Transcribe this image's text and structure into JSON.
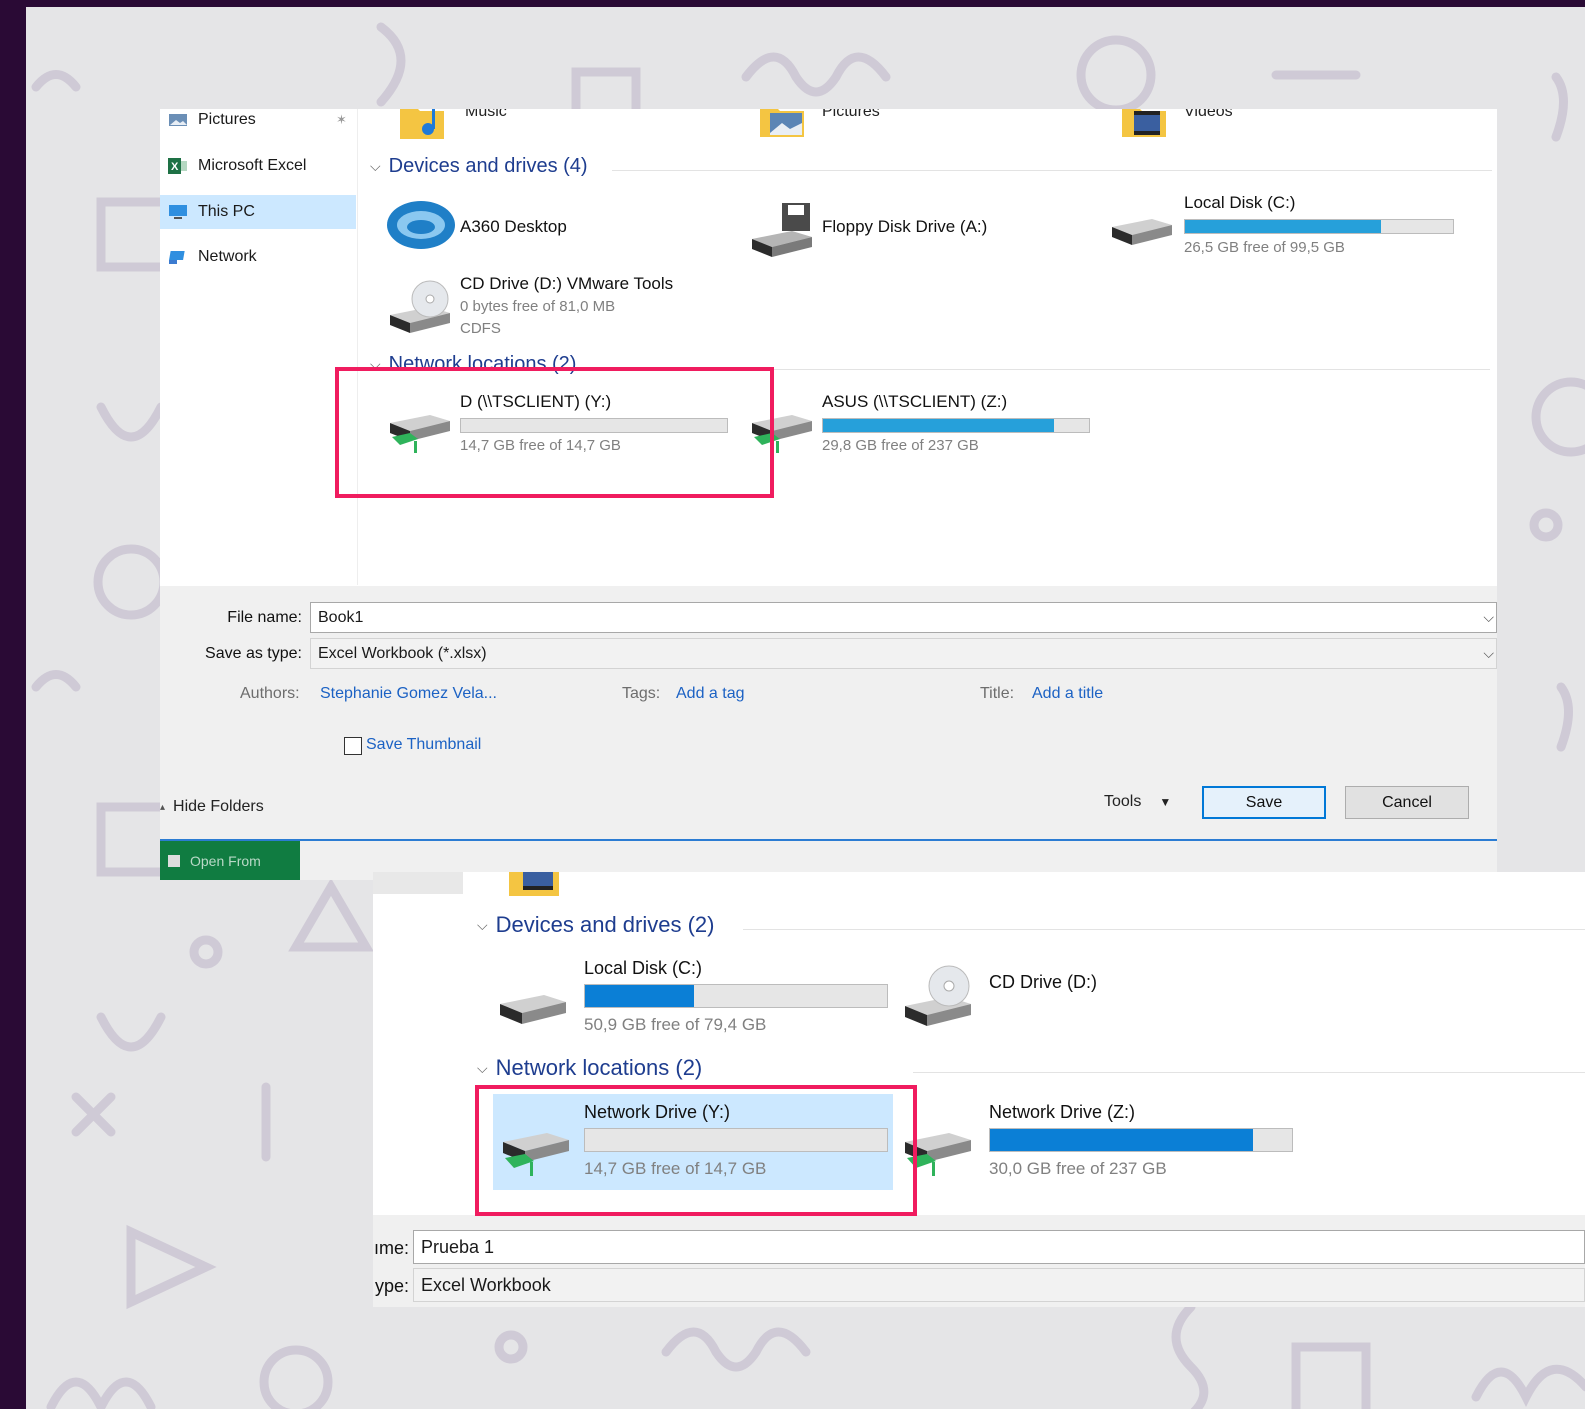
{
  "colors": {
    "frame": "#2a0a35",
    "backdrop": "#e5e5e7",
    "highlight": "#f01c5f",
    "accent": "#26a0da",
    "link": "#1c62c4",
    "selection": "#cce8ff"
  },
  "dialog1": {
    "nav": [
      {
        "label": "Pictures",
        "icon": "pictures-icon",
        "pinned": true
      },
      {
        "label": "Microsoft Excel",
        "icon": "excel-icon"
      },
      {
        "label": "This PC",
        "icon": "this-pc-icon",
        "selected": true
      },
      {
        "label": "Network",
        "icon": "network-icon"
      }
    ],
    "folders_top": [
      {
        "label": "Music",
        "icon": "music-folder-icon"
      },
      {
        "label": "Pictures",
        "icon": "pictures-folder-icon"
      },
      {
        "label": "Videos",
        "icon": "videos-folder-icon"
      }
    ],
    "devices_header": "Devices and drives (4)",
    "devices": [
      {
        "name": "A360 Desktop",
        "icon": "a360-desktop-icon"
      },
      {
        "name": "Floppy Disk Drive (A:)",
        "icon": "floppy-drive-icon"
      },
      {
        "name": "Local Disk (C:)",
        "icon": "hard-disk-icon",
        "free_text": "26,5 GB free of 99,5 GB",
        "used_fraction": 0.73
      },
      {
        "name": "CD Drive (D:) VMware Tools",
        "icon": "cd-drive-icon",
        "sub1": "0 bytes free of 81,0 MB",
        "sub2": "CDFS"
      }
    ],
    "network_header": "Network locations (2)",
    "network": [
      {
        "name": "D (\\\\TSCLIENT) (Y:)",
        "icon": "network-drive-icon",
        "free_text": "14,7 GB free of 14,7 GB",
        "used_fraction": 0.0
      },
      {
        "name": "ASUS (\\\\TSCLIENT) (Z:)",
        "icon": "network-drive-icon",
        "free_text": "29,8 GB free of 237 GB",
        "used_fraction": 0.87
      }
    ],
    "file_name_label": "File name:",
    "file_name_value": "Book1",
    "save_type_label": "Save as type:",
    "save_type_value": "Excel Workbook (*.xlsx)",
    "authors_label": "Authors:",
    "authors_value": "Stephanie Gomez Vela...",
    "tags_label": "Tags:",
    "tags_value": "Add a tag",
    "title_label": "Title:",
    "title_value": "Add a title",
    "thumbnail_label": "Save Thumbnail",
    "hide_folders": "Hide Folders",
    "tools_label": "Tools",
    "save_label": "Save",
    "cancel_label": "Cancel",
    "taskbar_label": "Open From"
  },
  "dialog2": {
    "devices_header": "Devices and drives (2)",
    "devices": [
      {
        "name": "Local Disk (C:)",
        "icon": "hard-disk-icon",
        "free_text": "50,9 GB free of 79,4 GB",
        "used_fraction": 0.36
      },
      {
        "name": "CD Drive (D:)",
        "icon": "cd-drive-icon"
      }
    ],
    "network_header": "Network locations (2)",
    "network": [
      {
        "name": "Network Drive (Y:)",
        "icon": "network-drive-icon",
        "free_text": "14,7 GB free of 14,7 GB",
        "used_fraction": 0.0,
        "selected": true
      },
      {
        "name": "Network Drive (Z:)",
        "icon": "network-drive-icon",
        "free_text": "30,0 GB free of 237 GB",
        "used_fraction": 0.87
      }
    ],
    "file_name_label": "ıme:",
    "file_name_value": "Prueba 1",
    "save_type_label": "ype:",
    "save_type_value": "Excel Workbook"
  }
}
